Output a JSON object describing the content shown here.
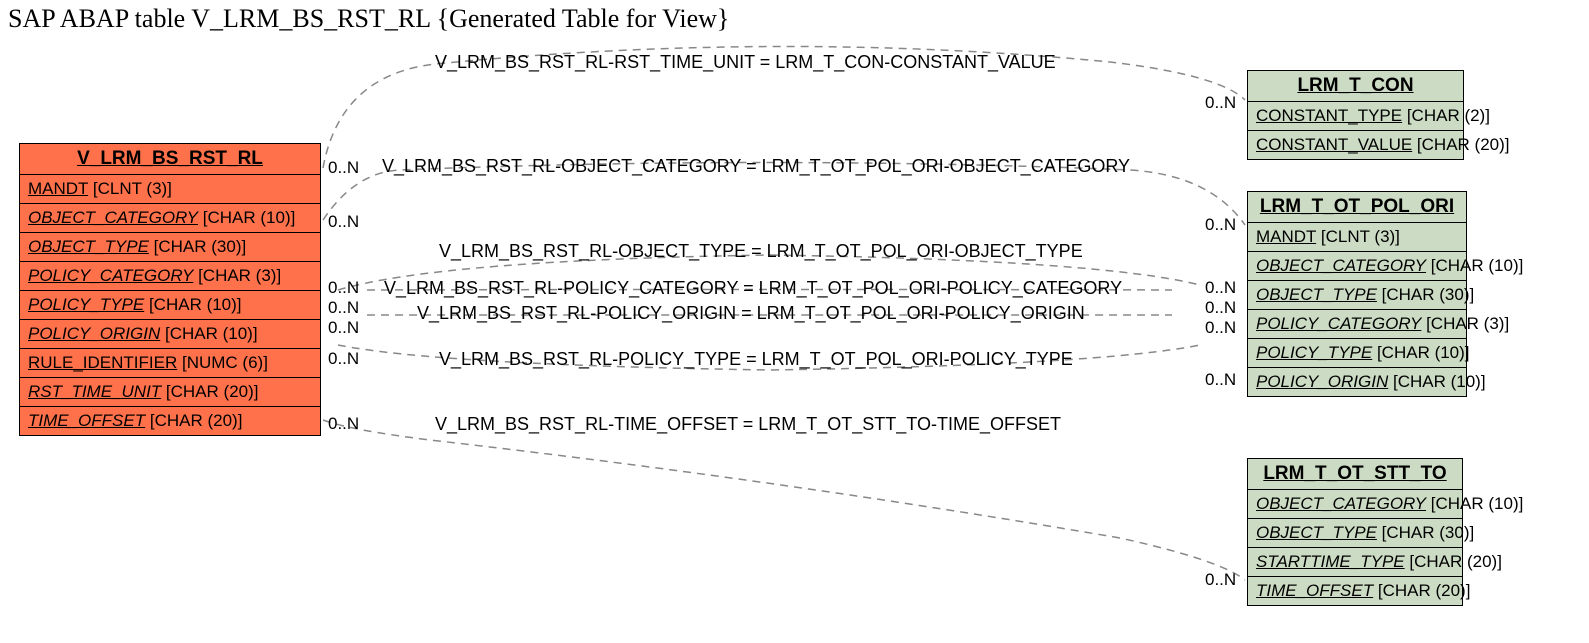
{
  "title": "SAP ABAP table V_LRM_BS_RST_RL {Generated Table for View}",
  "entities": {
    "main": {
      "name": "V_LRM_BS_RST_RL",
      "fields": [
        {
          "name": "MANDT",
          "type": "[CLNT (3)]",
          "italic": false
        },
        {
          "name": "OBJECT_CATEGORY",
          "type": "[CHAR (10)]",
          "italic": true
        },
        {
          "name": "OBJECT_TYPE",
          "type": "[CHAR (30)]",
          "italic": true
        },
        {
          "name": "POLICY_CATEGORY",
          "type": "[CHAR (3)]",
          "italic": true
        },
        {
          "name": "POLICY_TYPE",
          "type": "[CHAR (10)]",
          "italic": true
        },
        {
          "name": "POLICY_ORIGIN",
          "type": "[CHAR (10)]",
          "italic": true
        },
        {
          "name": "RULE_IDENTIFIER",
          "type": "[NUMC (6)]",
          "italic": false
        },
        {
          "name": "RST_TIME_UNIT",
          "type": "[CHAR (20)]",
          "italic": true
        },
        {
          "name": "TIME_OFFSET",
          "type": "[CHAR (20)]",
          "italic": true
        }
      ]
    },
    "con": {
      "name": "LRM_T_CON",
      "fields": [
        {
          "name": "CONSTANT_TYPE",
          "type": "[CHAR (2)]",
          "italic": false
        },
        {
          "name": "CONSTANT_VALUE",
          "type": "[CHAR (20)]",
          "italic": false
        }
      ]
    },
    "pol": {
      "name": "LRM_T_OT_POL_ORI",
      "fields": [
        {
          "name": "MANDT",
          "type": "[CLNT (3)]",
          "italic": false
        },
        {
          "name": "OBJECT_CATEGORY",
          "type": "[CHAR (10)]",
          "italic": true
        },
        {
          "name": "OBJECT_TYPE",
          "type": "[CHAR (30)]",
          "italic": true
        },
        {
          "name": "POLICY_CATEGORY",
          "type": "[CHAR (3)]",
          "italic": true
        },
        {
          "name": "POLICY_TYPE",
          "type": "[CHAR (10)]",
          "italic": true
        },
        {
          "name": "POLICY_ORIGIN",
          "type": "[CHAR (10)]",
          "italic": true
        }
      ]
    },
    "stt": {
      "name": "LRM_T_OT_STT_TO",
      "fields": [
        {
          "name": "OBJECT_CATEGORY",
          "type": "[CHAR (10)]",
          "italic": true
        },
        {
          "name": "OBJECT_TYPE",
          "type": "[CHAR (30)]",
          "italic": true
        },
        {
          "name": "STARTTIME_TYPE",
          "type": "[CHAR (20)]",
          "italic": true
        },
        {
          "name": "TIME_OFFSET",
          "type": "[CHAR (20)]",
          "italic": true
        }
      ]
    }
  },
  "relations": [
    {
      "text": "V_LRM_BS_RST_RL-RST_TIME_UNIT = LRM_T_CON-CONSTANT_VALUE"
    },
    {
      "text": "V_LRM_BS_RST_RL-OBJECT_CATEGORY = LRM_T_OT_POL_ORI-OBJECT_CATEGORY"
    },
    {
      "text": "V_LRM_BS_RST_RL-OBJECT_TYPE = LRM_T_OT_POL_ORI-OBJECT_TYPE"
    },
    {
      "text": "V_LRM_BS_RST_RL-POLICY_CATEGORY = LRM_T_OT_POL_ORI-POLICY_CATEGORY"
    },
    {
      "text": "V_LRM_BS_RST_RL-POLICY_ORIGIN = LRM_T_OT_POL_ORI-POLICY_ORIGIN"
    },
    {
      "text": "V_LRM_BS_RST_RL-POLICY_TYPE = LRM_T_OT_POL_ORI-POLICY_TYPE"
    },
    {
      "text": "V_LRM_BS_RST_RL-TIME_OFFSET = LRM_T_OT_STT_TO-TIME_OFFSET"
    }
  ],
  "cardinality": "0..N"
}
